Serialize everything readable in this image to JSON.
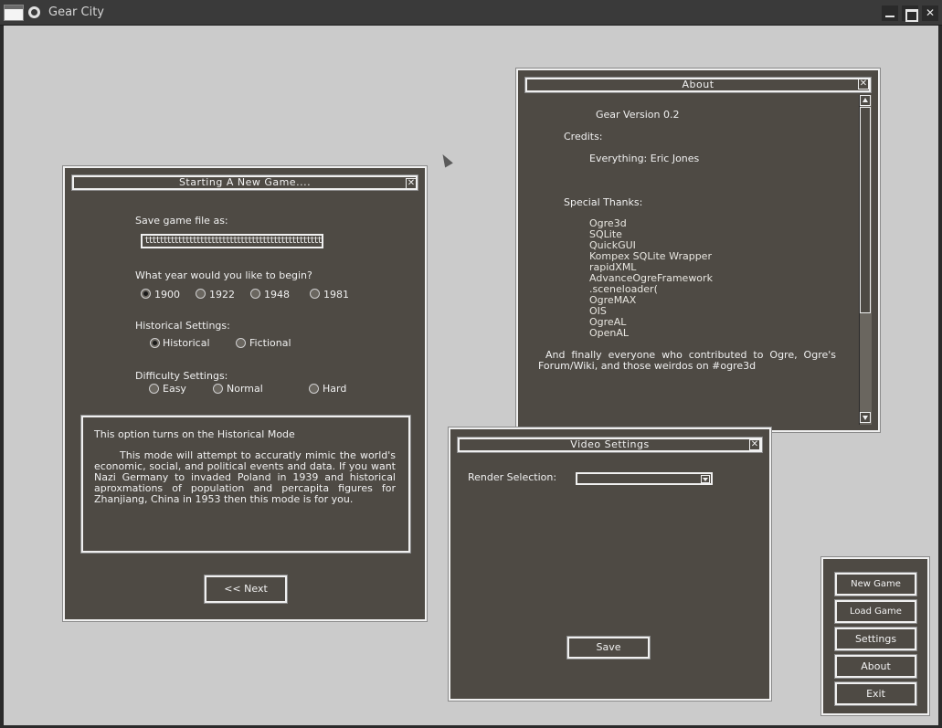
{
  "window": {
    "title": "Gear City",
    "controls": {
      "minimize": "",
      "maximize": "",
      "close": "✕"
    }
  },
  "new_game": {
    "title": "Starting A New Game....",
    "close": "✕",
    "save_label": "Save game file as:",
    "save_value": "tttttttttttttttttttttttttttttttttttttttttttttttttttttttttttttttttttttttt",
    "year_label": "What year would you like to begin?",
    "years": [
      "1900",
      "1922",
      "1948",
      "1981"
    ],
    "selected_year": "1900",
    "historical_label": "Historical Settings:",
    "historical_options": [
      "Historical",
      "Fictional"
    ],
    "selected_historical": "Historical",
    "difficulty_label": "Difficulty Settings:",
    "difficulty_options": [
      "Easy",
      "Normal",
      "Hard"
    ],
    "info_title": "This option turns on the Historical Mode",
    "info_body": "This mode will attempt to accuratly mimic the world's economic, social, and political events and data. If you want Nazi Germany to invaded Poland in 1939 and historical aproxmations of population and percapita figures for Zhanjiang, China in 1953 then this mode is for you.",
    "next_button": "<< Next"
  },
  "about": {
    "title": "About",
    "close": "✕",
    "version": "Gear Version 0.2",
    "credits_label": "Credits:",
    "credits": "Everything: Eric Jones",
    "thanks_label": "Special Thanks:",
    "thanks": [
      "Ogre3d",
      "SQLite",
      "QuickGUI",
      "Kompex SQLite Wrapper",
      "rapidXML",
      "AdvanceOgreFramework",
      ".sceneloader(",
      "OgreMAX",
      "OIS",
      "OgreAL",
      "OpenAL"
    ],
    "closing": "And finally everyone who contributed to Ogre, Ogre's Forum/Wiki, and those weirdos on #ogre3d"
  },
  "video": {
    "title": "Video Settings",
    "close": "✕",
    "render_label": "Render Selection:",
    "render_value": "",
    "save_button": "Save"
  },
  "menu": {
    "new_game": "New Game",
    "load_game": "Load Game",
    "settings": "Settings",
    "about": "About",
    "exit": "Exit"
  }
}
